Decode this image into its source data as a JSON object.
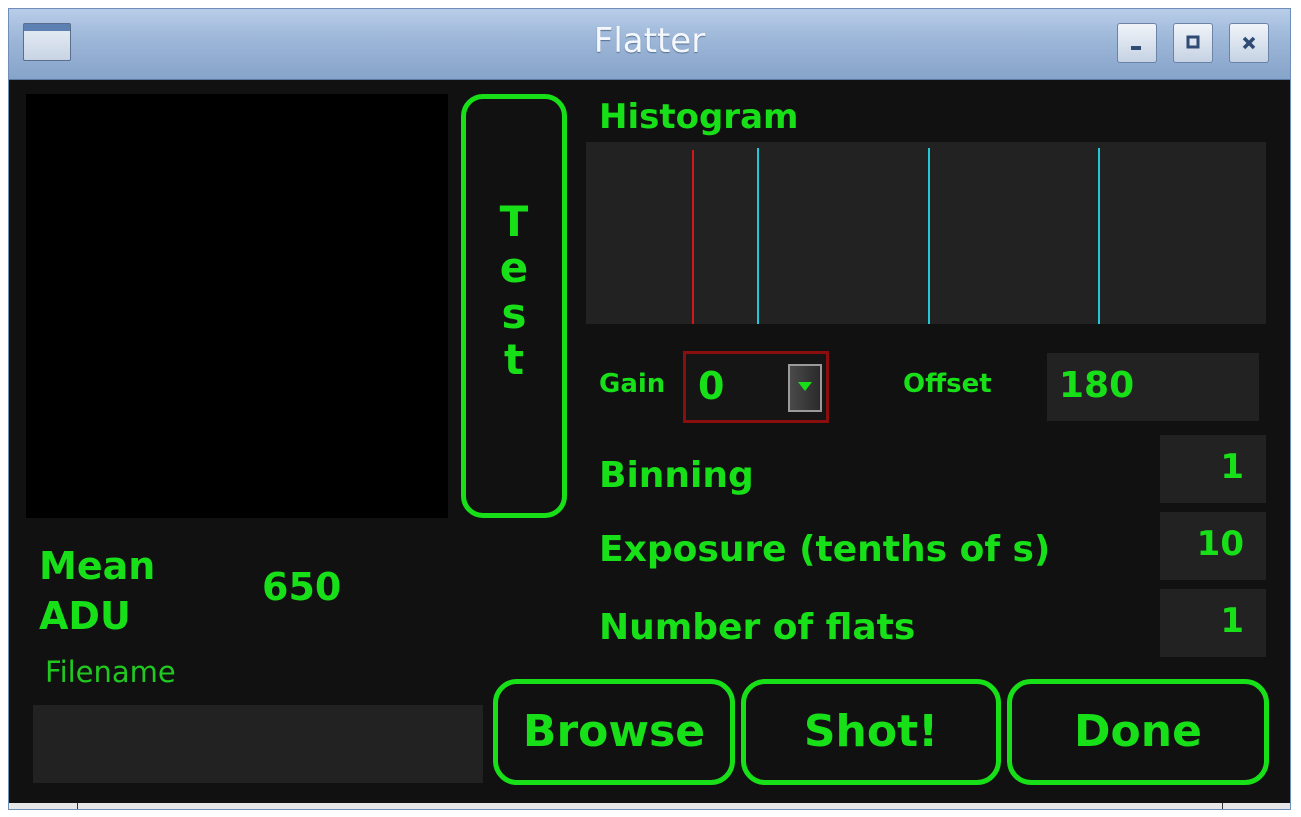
{
  "window": {
    "title": "Flatter",
    "controls": {
      "minimize_icon": "minimize-icon",
      "maximize_icon": "maximize-icon",
      "close_icon": "close-icon"
    }
  },
  "test_button": {
    "letters": [
      "T",
      "e",
      "s",
      "t"
    ]
  },
  "histogram": {
    "label": "Histogram",
    "markers": [
      {
        "color": "#d01818"
      },
      {
        "color": "#22c8d8"
      },
      {
        "color": "#22c8d8"
      },
      {
        "color": "#22c8d8"
      }
    ]
  },
  "gain": {
    "label": "Gain",
    "value": "0"
  },
  "offset": {
    "label": "Offset",
    "value": "180"
  },
  "binning": {
    "label": "Binning",
    "value": "1"
  },
  "exposure": {
    "label": "Exposure (tenths of s)",
    "value": "10"
  },
  "number_of_flats": {
    "label": "Number of flats",
    "value": "1"
  },
  "mean_adu": {
    "label_line1": "Mean",
    "label_line2": "ADU",
    "value": "650"
  },
  "filename": {
    "label": "Filename",
    "value": ""
  },
  "buttons": {
    "browse": "Browse",
    "shot": "Shot!",
    "done": "Done"
  },
  "colors": {
    "accent_green": "#18e018",
    "background": "#111111",
    "field_background": "#222222",
    "gain_border": "#8a0e0e"
  }
}
